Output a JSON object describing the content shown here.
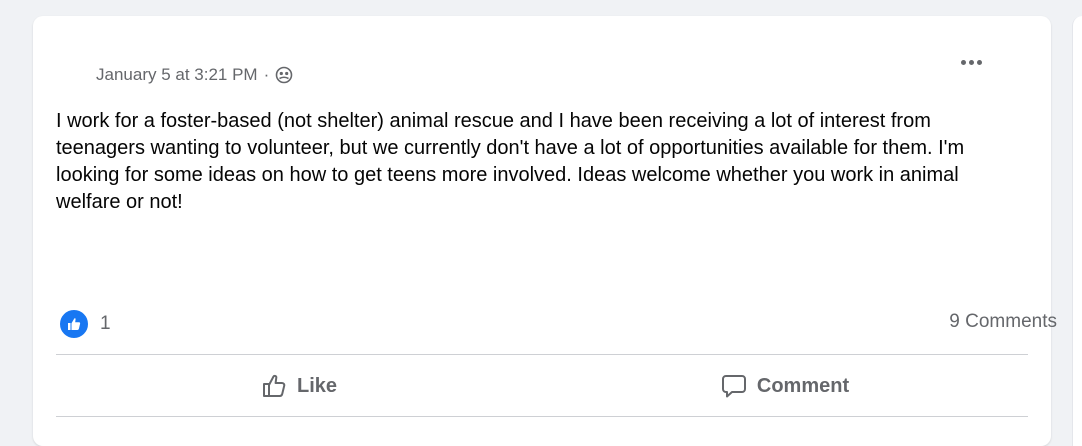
{
  "post": {
    "timestamp": "January 5 at 3:21 PM",
    "separator": "·",
    "audience_icon": "group-globe-icon",
    "body": "I work for a foster-based (not shelter) animal rescue and I have been receiving a lot of interest from teenagers wanting to volunteer, but we currently don't have a lot of opportunities available for them. I'm looking for some ideas on how to get teens more involved. Ideas welcome whether you work in animal welfare or not!"
  },
  "engagement": {
    "reaction_icon": "like-reaction-icon",
    "reaction_count": "1",
    "comments_label": "9 Comments"
  },
  "actions": {
    "like_label": "Like",
    "comment_label": "Comment"
  },
  "colors": {
    "accent": "#1877f2",
    "secondary_text": "#65676b",
    "primary_text": "#050505",
    "divider": "#ced0d4"
  }
}
